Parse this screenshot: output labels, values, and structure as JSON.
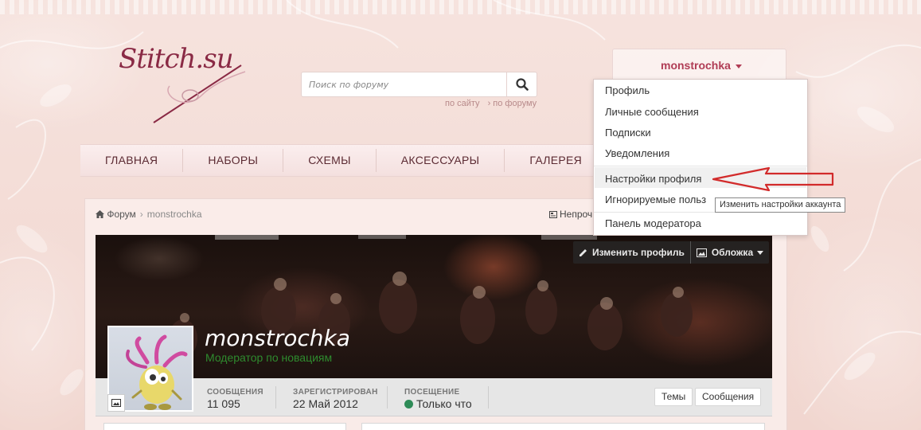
{
  "logo": {
    "text": "Stitch.su"
  },
  "search": {
    "placeholder": "Поиск по форуму",
    "scope_site": "по сайту",
    "scope_forum": "по форуму"
  },
  "nav": {
    "items": [
      {
        "label": "ГЛАВНАЯ"
      },
      {
        "label": "НАБОРЫ"
      },
      {
        "label": "СХЕМЫ"
      },
      {
        "label": "АКСЕССУАРЫ"
      },
      {
        "label": "ГАЛЕРЕЯ"
      }
    ]
  },
  "user": {
    "name": "monstrochka"
  },
  "dropdown": {
    "items": [
      {
        "label": "Профиль"
      },
      {
        "label": "Личные сообщения"
      },
      {
        "label": "Подписки"
      },
      {
        "label": "Уведомления"
      },
      {
        "label": "Настройки профиля"
      },
      {
        "label": "Игнорируемые польз"
      },
      {
        "label": "Панель модератора"
      }
    ],
    "tooltip": "Изменить настройки аккаунта"
  },
  "breadcrumb": {
    "home": "Форум",
    "current": "monstrochka"
  },
  "unread_label": "Непроч",
  "cover": {
    "edit_profile": "Изменить профиль",
    "cover_label": "Обложка"
  },
  "profile": {
    "name": "monstrochka",
    "role": "Модератор по новациям"
  },
  "stats": {
    "posts_label": "СООБЩЕНИЯ",
    "posts_value": "11 095",
    "registered_label": "ЗАРЕГИСТРИРОВАН",
    "registered_value": "22 Май 2012",
    "visit_label": "ПОСЕЩЕНИЕ",
    "visit_value": "Только что"
  },
  "buttons": {
    "topics": "Темы",
    "posts": "Сообщения"
  },
  "colors": {
    "accent": "#b03c55",
    "nav_text": "#5b2a32",
    "online": "#2e8b57",
    "role": "#2e8b2e",
    "arrow": "#d22b2b"
  }
}
